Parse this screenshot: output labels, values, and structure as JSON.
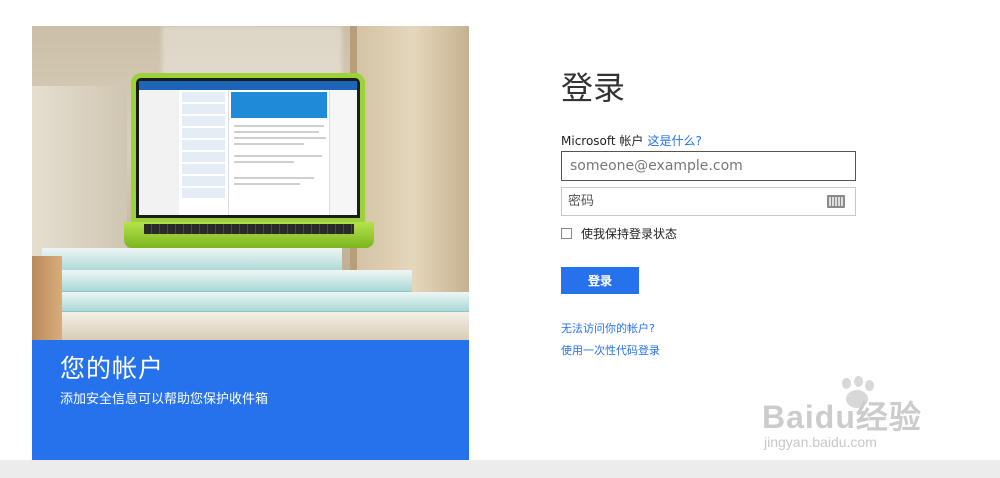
{
  "hero": {
    "title": "您的帐户",
    "subtitle": "添加安全信息可以帮助您保护收件箱"
  },
  "form": {
    "title": "登录",
    "account_label": "Microsoft 帐户",
    "what_is_this": "这是什么?",
    "email_placeholder": "someone@example.com",
    "password_placeholder": "密码",
    "keep_signed_in": "使我保持登录状态",
    "submit_label": "登录",
    "cant_access": "无法访问你的帐户?",
    "one_time_code": "使用一次性代码登录"
  },
  "watermark": {
    "brand": "Baidu经验",
    "url": "jingyan.baidu.com"
  },
  "colors": {
    "accent": "#2672ec",
    "footer": "#ececec"
  }
}
